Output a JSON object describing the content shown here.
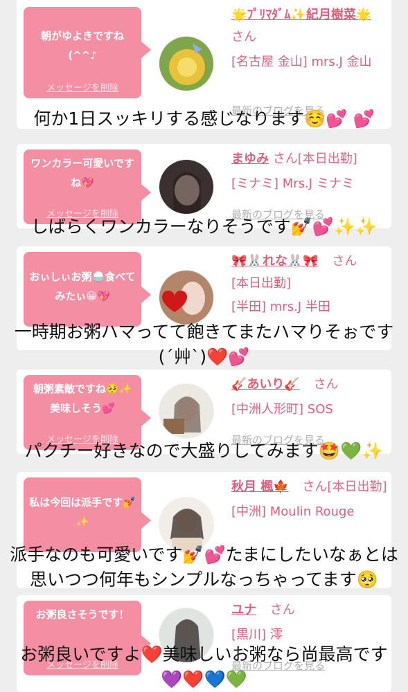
{
  "cards": [
    {
      "bubble": "朝がゆよきですね(^^♪",
      "delete_label": "メッセージを削除",
      "name": "🌟ﾌﾟﾘﾏﾀﾞﾑ✨紀月樹菜🌟",
      "honorific": "さん",
      "store": "[名古屋 金山] mrs.J 金山",
      "blog_label": "最新のブログを見る",
      "comment": "何か1日スッキリする感じなります☺️💕 💕"
    },
    {
      "bubble": "ワンカラー可愛いですね💖",
      "delete_label": "メッセージを削除",
      "name": "まゆみ",
      "honorific": "さん[本日出勤]",
      "store": "[ミナミ] Mrs.J ミナミ",
      "blog_label": "最新のブログを見る",
      "comment": "しばらくワンカラーなりそうです💅💕✨✨"
    },
    {
      "bubble": "おぃしぃお粥🍚食べてみたぃ😀💖",
      "delete_label": "",
      "name": "🎀🐰れな🐰🎀",
      "honorific": "さん",
      "store_lines": [
        "[本日出勤]",
        "[半田] mrs.J 半田"
      ],
      "blog_label": "",
      "comment": "一時期お粥ハマってて飽きてまたハマりそぉです(´艸`)❤️💕"
    },
    {
      "bubble": "朝粥素敵ですね🥺✨美味しそう💕",
      "delete_label": "メッセージを削除",
      "name": "🎸あいり🎸",
      "honorific": "さん",
      "store": "[中洲人形町] SOS",
      "blog_label": "最新のブログを見る",
      "comment": "パクチー好きなので大盛りしてみます🤩💚✨"
    },
    {
      "bubble": "私は今回は派手です💅✨",
      "delete_label": "",
      "name": "秋月 楓🍁",
      "honorific": "さん[本日出勤]",
      "store": "[中洲] Moulin Rouge",
      "blog_label": "",
      "comment": "派手なのも可愛いです💅💕たまにしたいなぁとは思いつつ何年もシンプルなっちゃってます🥺"
    },
    {
      "bubble": "お粥良さそうです！",
      "delete_label": "メッセージを削除",
      "name": "ユナ",
      "honorific": "さん",
      "store": "[黒川] 澪",
      "blog_label": "最新のブログを見る",
      "comment": "お粥良いですよ❤️美味しいお粥なら尚最高です💜❤️💙💚"
    }
  ]
}
